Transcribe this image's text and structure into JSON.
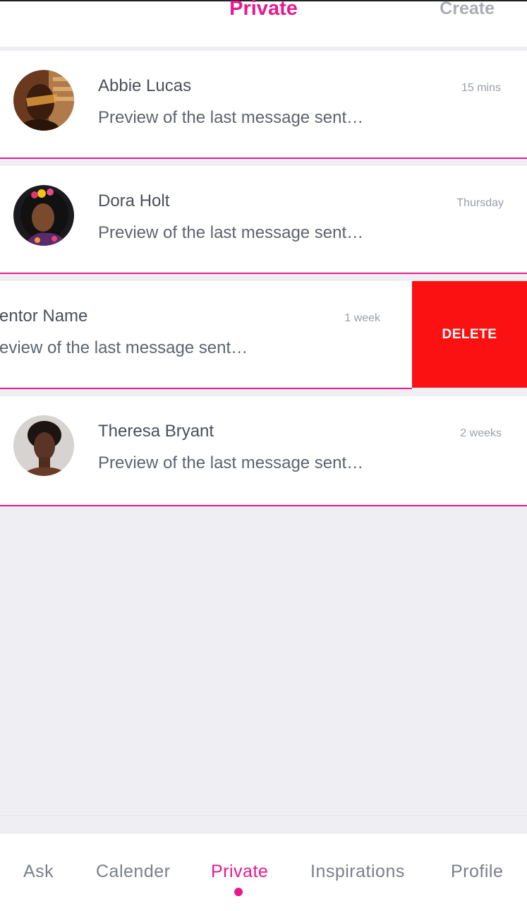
{
  "header": {
    "title": "Private",
    "action": "Create"
  },
  "conversations": [
    {
      "name": "Abbie Lucas",
      "preview": "Preview of the last message sent…",
      "time": "15 mins"
    },
    {
      "name": "Dora Holt",
      "preview": "Preview of the last message sent…",
      "time": "Thursday"
    },
    {
      "name": "entor Name",
      "preview": "eview of the last message sent…",
      "time": "1 week",
      "action": "DELETE"
    },
    {
      "name": "Theresa Bryant",
      "preview": "Preview of the last message sent…",
      "time": "2 weeks"
    }
  ],
  "tabs": [
    "Ask",
    "Calender",
    "Private",
    "Inspirations",
    "Profile"
  ],
  "active_tab": "Private",
  "colors": {
    "accent": "#e8198f",
    "delete": "#fb1111",
    "background": "#eeeef3"
  }
}
